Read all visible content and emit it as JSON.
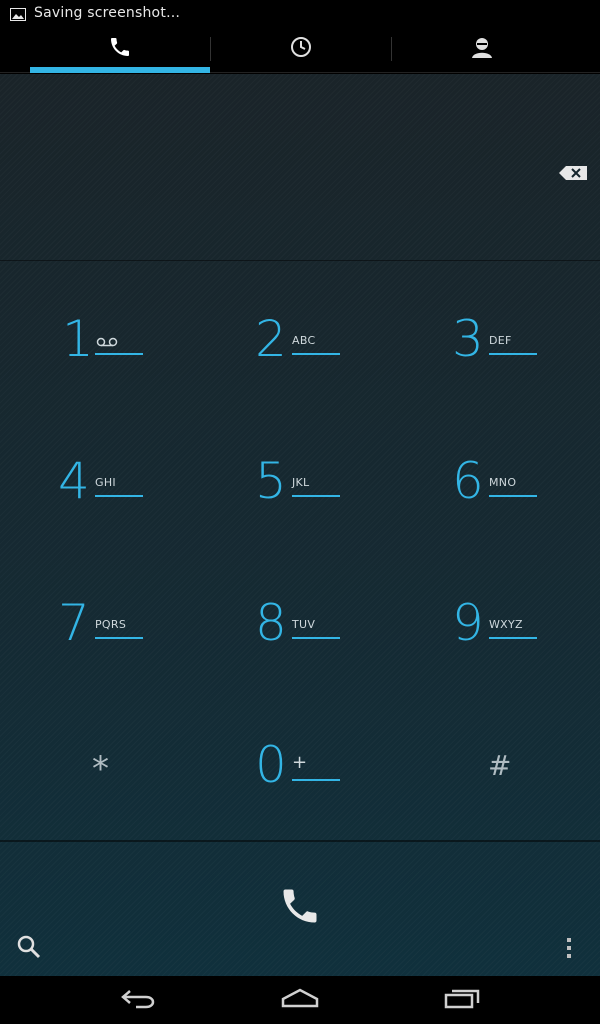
{
  "status_bar": {
    "notification_text": "Saving screenshot…",
    "icon": "image-icon"
  },
  "tabs": [
    {
      "icon": "phone-icon",
      "selected": true
    },
    {
      "icon": "clock-icon",
      "selected": false
    },
    {
      "icon": "contacts-icon",
      "selected": false
    }
  ],
  "dialer": {
    "digits_value": "",
    "backspace_icon": "backspace-icon",
    "keys": [
      {
        "digit": "1",
        "letters": "",
        "icon": "voicemail-icon"
      },
      {
        "digit": "2",
        "letters": "ABC"
      },
      {
        "digit": "3",
        "letters": "DEF"
      },
      {
        "digit": "4",
        "letters": "GHI"
      },
      {
        "digit": "5",
        "letters": "JKL"
      },
      {
        "digit": "6",
        "letters": "MNO"
      },
      {
        "digit": "7",
        "letters": "PQRS"
      },
      {
        "digit": "8",
        "letters": "TUV"
      },
      {
        "digit": "9",
        "letters": "WXYZ"
      },
      {
        "digit": "*",
        "letters": ""
      },
      {
        "digit": "0",
        "letters": "+"
      },
      {
        "digit": "#",
        "letters": ""
      }
    ],
    "call_icon": "phone-icon",
    "search_icon": "search-icon",
    "overflow_icon": "overflow-menu-icon"
  },
  "nav_bar": {
    "back_icon": "back-icon",
    "home_icon": "home-icon",
    "recents_icon": "recents-icon"
  },
  "colors": {
    "accent": "#33b5e5",
    "background": "#15252d",
    "text": "#cfd8dc"
  }
}
